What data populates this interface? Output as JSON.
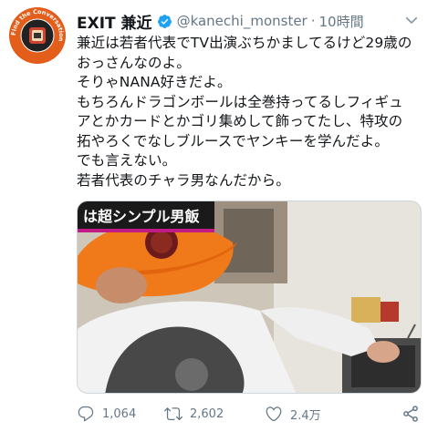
{
  "tweet": {
    "display_name": "EXIT 兼近",
    "handle": "@kanechi_monster",
    "separator": "·",
    "time": "10時間",
    "text": "兼近は若者代表でTV出演ぶちかましてるけど29歳の\nおっさんなのよ。\nそりゃNANA好きだよ。\nもちろんドラゴンボールは全巻持ってるしフィギュ\nアとかカードとかゴリ集めして飾ってたし、特攻の\n拓やろくでなしブルースでヤンキーを学んだよ。\nでも言えない。\n若者代表のチャラ男なんだから。",
    "avatar_ring_text": "Find the Conversation",
    "verified": true
  },
  "media": {
    "caption": "は超シンプル男飯",
    "caption_bg": "#1a1a1a",
    "caption_color": "#ffffff",
    "accent": "#c01a86"
  },
  "actions": {
    "replies": "1,064",
    "retweets": "2,602",
    "likes": "2.4万",
    "share_icon": "share-icon"
  },
  "colors": {
    "verified_blue": "#1da1f2",
    "secondary_text": "#657786",
    "primary_text": "#14171a",
    "cap_orange": "#f07a1a"
  }
}
